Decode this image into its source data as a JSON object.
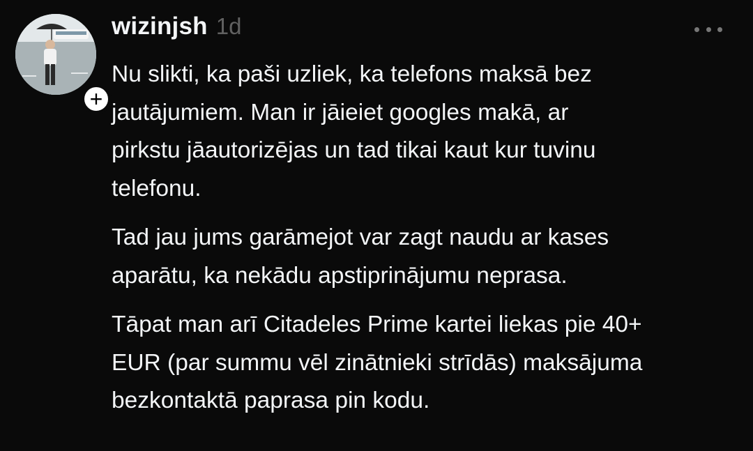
{
  "post": {
    "author": {
      "username": "wizinjsh",
      "avatar": "profile-photo",
      "follow_icon": "+"
    },
    "timestamp": "1d",
    "more_icon": "more-icon",
    "paragraphs": [
      "Nu slikti, ka paši uzliek, ka telefons maksā bez\njautājumiem. Man ir jāieiet googles makā, ar\npirkstu jāautorizējas un tad tikai kaut kur tuvinu\ntelefonu.",
      "Tad jau jums garāmejot var zagt naudu ar kases\naparātu, ka nekādu apstiprinājumu neprasa.",
      "Tāpat man arī Citadeles Prime kartei liekas pie 40+\nEUR (par summu vēl zinātnieki strīdās) maksājuma\nbezkontaktā paprasa pin kodu."
    ]
  }
}
